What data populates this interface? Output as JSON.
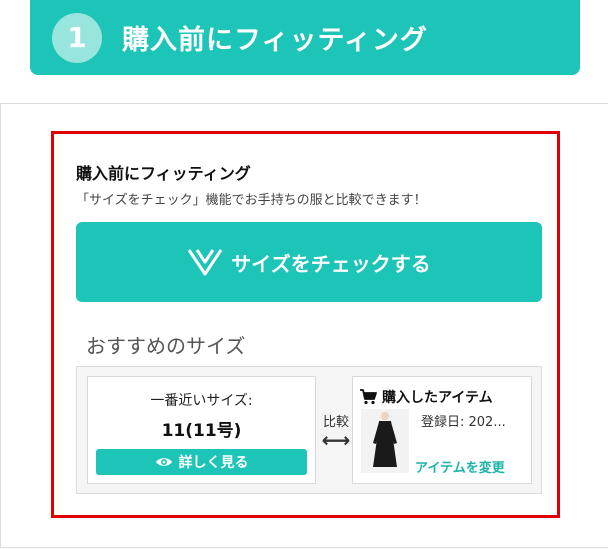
{
  "header": {
    "step_number": "1",
    "title": "購入前にフィッティング"
  },
  "widget": {
    "title": "購入前にフィッティング",
    "subtitle": "「サイズをチェック」機能でお手持ちの服と比較できます！",
    "check_button_label": "サイズをチェックする",
    "recommended_title": "おすすめのサイズ",
    "size_card": {
      "label": "一番近いサイズ:",
      "value": "11(11号)",
      "detail_button_label": "詳しく見る"
    },
    "compare": {
      "label": "比較",
      "arrow": "⟷"
    },
    "item_card": {
      "title": "購入したアイテム",
      "date": "登録日: 202...",
      "change_label": "アイテムを変更"
    }
  },
  "colors": {
    "accent": "#1cc5b7",
    "highlight_border": "#e00000"
  },
  "icons": {
    "brand_logo": "v-logo-icon",
    "eye": "eye-icon",
    "cart": "cart-icon",
    "item_thumbnail": "dress-thumbnail"
  }
}
